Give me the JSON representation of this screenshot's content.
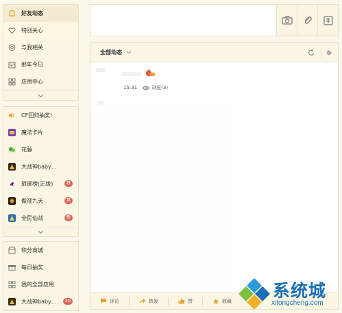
{
  "sidebar": {
    "primary": [
      {
        "label": "好友动态",
        "icon": "qzone-bell-icon"
      },
      {
        "label": "特别关心",
        "icon": "heart-icon"
      },
      {
        "label": "与我相关",
        "icon": "at-icon"
      },
      {
        "label": "那年今日",
        "icon": "calendar-icon"
      },
      {
        "label": "应用中心",
        "icon": "apps-grid-icon"
      }
    ],
    "apps": [
      {
        "label": "CF回归抽奖!",
        "icon": "speaker-icon",
        "badge": ""
      },
      {
        "label": "魔法卡片",
        "icon": "magic-card-game-icon",
        "badge": ""
      },
      {
        "label": "花藤",
        "icon": "flower-vine-game-icon",
        "badge": ""
      },
      {
        "label": "大战神baby…",
        "icon": "god-war-game-icon",
        "badge": ""
      },
      {
        "label": "琅琊榜(正版)",
        "icon": "langya-game-icon",
        "badge": "荐"
      },
      {
        "label": "傲视九天",
        "icon": "aoshi-game-icon",
        "badge": "荐"
      },
      {
        "label": "全民仙战",
        "icon": "xianzhan-game-icon",
        "badge": "新"
      }
    ],
    "extras": [
      {
        "label": "积分商城",
        "icon": "shop-icon",
        "badge": ""
      },
      {
        "label": "每日抽奖",
        "icon": "gift-icon",
        "badge": ""
      },
      {
        "label": "我的全部应用",
        "icon": "apps-grid-icon",
        "badge": ""
      },
      {
        "label": "大战神baby…",
        "icon": "god-war-game-icon",
        "badge": "3D"
      }
    ]
  },
  "compose": {
    "placeholder": ""
  },
  "feed": {
    "filter_label": "全部动态",
    "post": {
      "time": "15:31",
      "views": "浏览(3)"
    },
    "actions": [
      {
        "label": "评论",
        "icon": "comment-icon"
      },
      {
        "label": "转发",
        "icon": "share-icon"
      },
      {
        "label": "赞",
        "icon": "like-icon"
      },
      {
        "label": "收藏",
        "icon": "star-icon"
      }
    ]
  },
  "watermark": {
    "text": "系统城",
    "url": "xitongcheng.com"
  },
  "colors": {
    "background": "#fbf7ea",
    "accent": "#e9b84a",
    "badge": "#d96a5a",
    "watermark": "#1a6fb5"
  }
}
